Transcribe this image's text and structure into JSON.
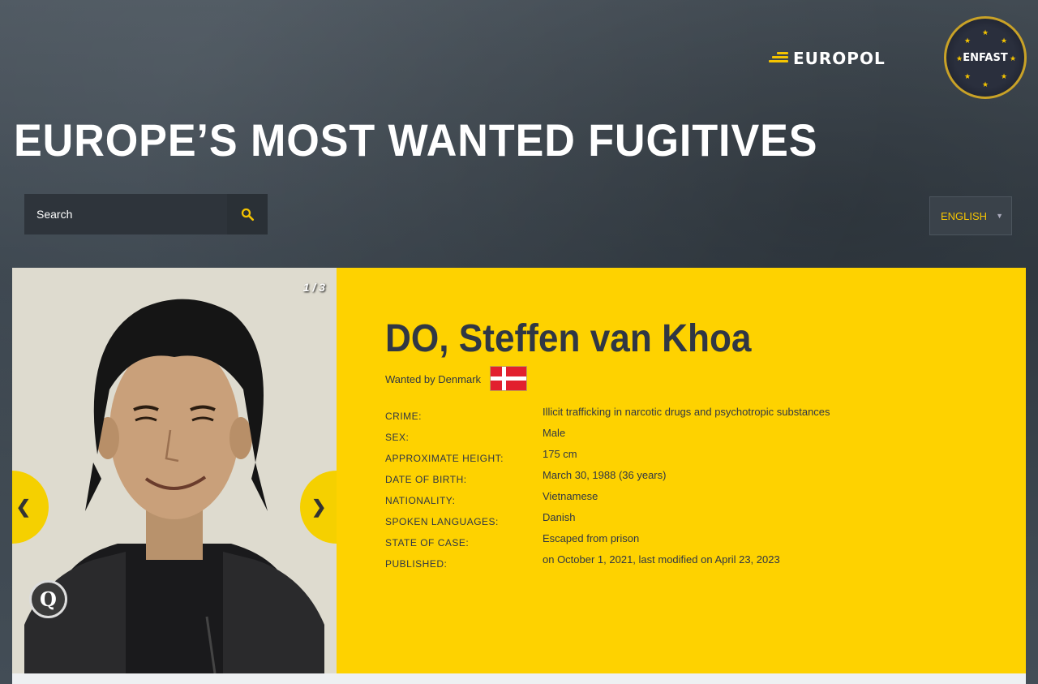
{
  "header": {
    "europol_logo_text": "EUROPOL",
    "enfast_logo_text": "ENFAST",
    "page_title": "EUROPE’S MOST WANTED FUGITIVES"
  },
  "search": {
    "placeholder": "Search",
    "icon": "search-icon"
  },
  "language": {
    "selected": "ENGLISH"
  },
  "gallery": {
    "counter": "1 / 3",
    "prev_label": "❮",
    "next_label": "❯",
    "zoom_label": "Q"
  },
  "fugitive": {
    "name": "DO, Steffen van Khoa",
    "wanted_by_prefix": "Wanted by",
    "wanted_by_country": "Denmark",
    "details": [
      {
        "label": "CRIME:",
        "value": "Illicit trafficking in narcotic drugs and psychotropic substances"
      },
      {
        "label": "SEX:",
        "value": "Male"
      },
      {
        "label": "APPROXIMATE HEIGHT:",
        "value": "175 cm"
      },
      {
        "label": "DATE OF BIRTH:",
        "value": "March 30, 1988 (36 years)"
      },
      {
        "label": "NATIONALITY:",
        "value": "Vietnamese"
      },
      {
        "label": "SPOKEN LANGUAGES:",
        "value": "Danish"
      },
      {
        "label": "STATE OF CASE:",
        "value": "Escaped from prison"
      },
      {
        "label": "PUBLISHED:",
        "value": "on October 1, 2021, last modified on April 23, 2023"
      }
    ]
  },
  "colors": {
    "accent_yellow": "#fed200",
    "text_dark": "#303744",
    "logo_gold": "#c9a227"
  }
}
